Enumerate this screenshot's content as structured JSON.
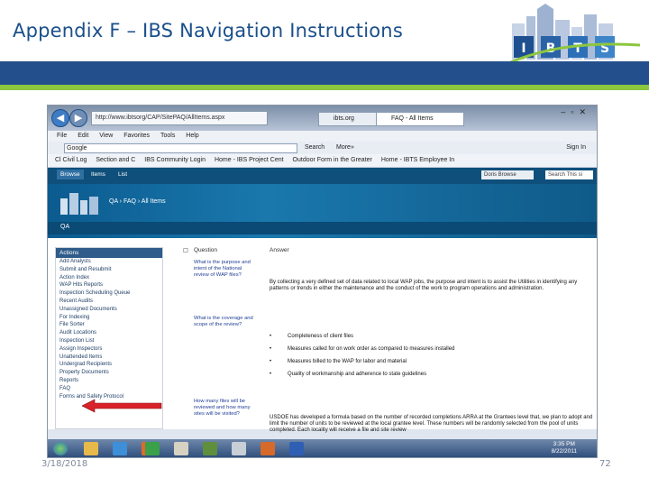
{
  "slide": {
    "title": "Appendix F – IBS Navigation Instructions",
    "date": "3/18/2018",
    "page_number": "72",
    "colors": {
      "title": "#1a4f8a",
      "band_blue": "#23508c",
      "band_green": "#8dc63f"
    }
  },
  "logo": {
    "letters": [
      "I",
      "B",
      "T",
      "S"
    ]
  },
  "browser": {
    "address": "http://www.ibtsorg/CAP/SitePAQ/AllItems.aspx",
    "tabs": [
      "ibts.org",
      "FAQ - All Items"
    ],
    "menu": [
      "File",
      "Edit",
      "View",
      "Favorites",
      "Tools",
      "Help"
    ],
    "google_input": "Google",
    "search_label": "Search",
    "more_label": "More»",
    "signin_label": "Sign In",
    "favorites": [
      "Cl Civil Log",
      "Section and C",
      "IBS Community Login",
      "Home - IBS Project Cent",
      "Outdoor Form in the Greater",
      "Home - IBTS Employee In"
    ]
  },
  "sharepoint": {
    "tabs": [
      "Browse",
      "Items",
      "List"
    ],
    "breadcrumb": "QA › FAQ › All Items",
    "qa_label": "QA",
    "search_placeholder": "Search This si",
    "dropdown": "Doris Browse",
    "nav_header": "Actions",
    "nav_items": [
      "Add Analysts",
      "Submit and Resubmit",
      "Action Index",
      "WAP Hits Reports",
      "Inspection Scheduling Queue",
      "Recent Audits",
      "Unassigned Documents",
      "For Indexing",
      "File Sorter",
      "Audit Locations",
      "Inspection List",
      "Assign Inspectors",
      "Unattended Items",
      "Undergrad Recipients",
      "Property Documents",
      "Reports",
      "FAQ",
      "Forms and Safety Protocol"
    ],
    "col_question": "Question",
    "col_answer": "Answer",
    "q1": "What is the purpose and intent of the National review of WAP files?",
    "a1": "By collecting a very defined set of data related to local WAP jobs, the purpose and intent is to assist the Utilities in identifying any patterns or trends in either the maintenance and the conduct of the work to program operations and administration.",
    "q2": "What is the coverage and scope of the review?",
    "bullets": [
      "Completeness of client files",
      "Measures called for on work order as compared to measures installed",
      "Measures billed to the WAP for labor and material",
      "Quality of workmanship and adherence to state guidelines"
    ],
    "q3": "How many files will be reviewed and how many sites will be visited?",
    "a3": "USDOE has developed a formula based on the number of recorded completions ARRA at the Grantees level that, we plan to adopt and limit the number of units to be reviewed at the local grantee level. These numbers will be randomly selected from the pool of units completed. Each locality will receive a file and site review"
  },
  "taskbar": {
    "time": "3:35 PM",
    "date": "8/22/2011"
  }
}
